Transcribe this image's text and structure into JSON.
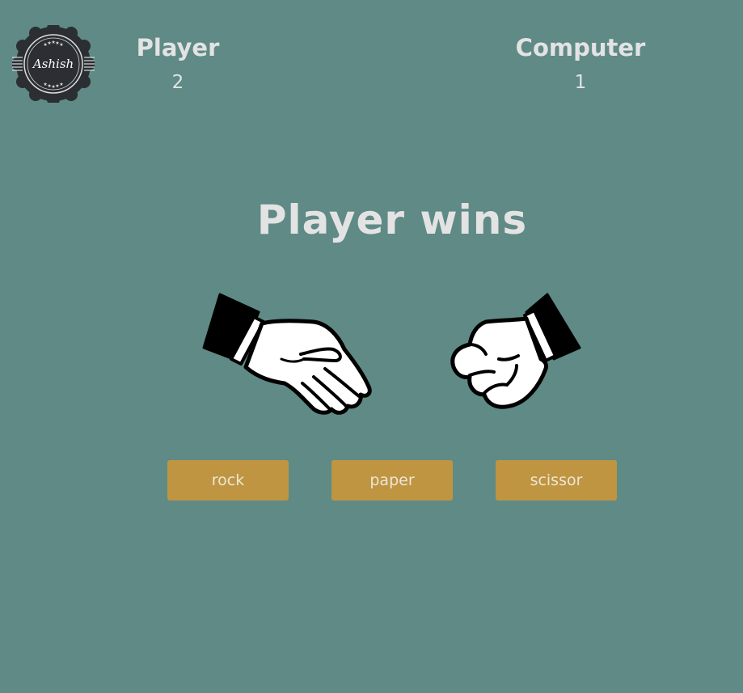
{
  "logo": {
    "text": "Ashish",
    "icon": "badge-logo-icon"
  },
  "scoreboard": {
    "player": {
      "label": "Player",
      "score": "2"
    },
    "computer": {
      "label": "Computer",
      "score": "1"
    }
  },
  "result": {
    "message": "Player wins"
  },
  "hands": {
    "player": {
      "icon": "open-hand-paper-icon",
      "choice": "paper"
    },
    "computer": {
      "icon": "fist-rock-icon",
      "choice": "rock"
    }
  },
  "controls": {
    "rock_label": "rock",
    "paper_label": "paper",
    "scissor_label": "scissor"
  },
  "colors": {
    "background": "#5f8a86",
    "button": "#bf9541",
    "text": "#e3e3e3",
    "logo_dark": "#2b2e33"
  }
}
